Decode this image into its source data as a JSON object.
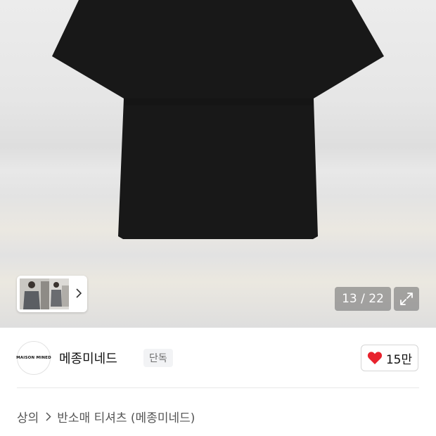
{
  "gallery": {
    "counter": "13 / 22",
    "icons": {
      "thumbnail_next": "chevron-right-icon",
      "expand": "expand-icon"
    }
  },
  "brand": {
    "logo_text": "MAISON MINED",
    "name": "메종미네드",
    "badge": "단독",
    "likes": "15만",
    "like_icon": "heart-icon",
    "like_color": "#e8222d"
  },
  "breadcrumb": {
    "category": "상의",
    "separator_icon": "chevron-right-icon",
    "subcategory": "반소매 티셔츠 (메종미네드)"
  }
}
